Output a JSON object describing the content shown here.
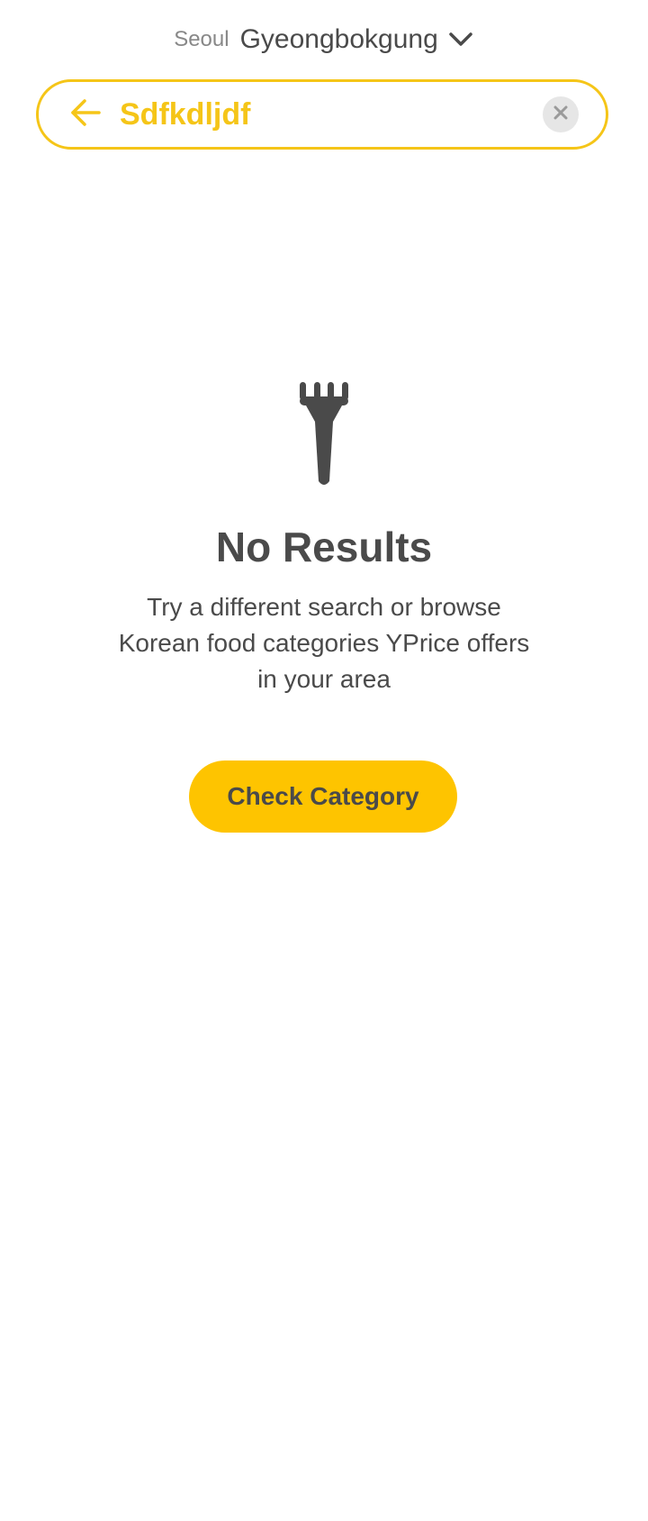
{
  "header": {
    "city": "Seoul",
    "place": "Gyeongbokgung"
  },
  "search": {
    "value": "Sdfkdljdf"
  },
  "empty_state": {
    "title": "No Results",
    "description": "Try a different search or browse Korean food categories YPrice offers in your area",
    "button_label": "Check Category"
  },
  "colors": {
    "accent": "#f5c518",
    "button": "#fec400",
    "text": "#4a4a4a",
    "muted": "#888888"
  },
  "icons": {
    "location_toggle": "chevron-down-icon",
    "back": "arrow-left-icon",
    "clear": "close-icon",
    "empty": "fork-icon"
  }
}
